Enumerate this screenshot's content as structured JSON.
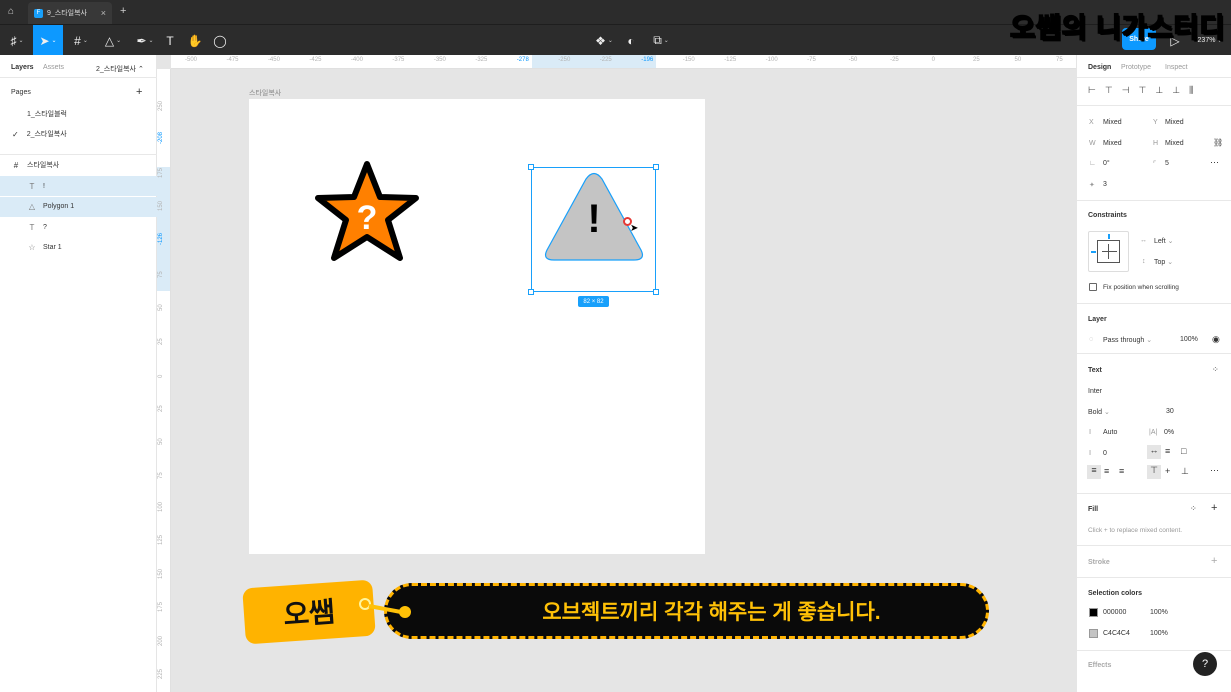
{
  "titlebar": {
    "tab_title": "9_스타일복사",
    "new_tab": "+"
  },
  "toolbar": {
    "share": "Share",
    "zoom": "237%"
  },
  "left_panel": {
    "tabs": [
      "Layers",
      "Assets"
    ],
    "current_page_dropdown": "2_스타일복사",
    "pages_title": "Pages",
    "pages": [
      {
        "name": "1_스타일블럭",
        "selected": false
      },
      {
        "name": "2_스타일복사",
        "selected": true
      }
    ],
    "frame_name": "스타일복사",
    "layers": [
      {
        "icon": "text-icon",
        "name": "!",
        "selected": true
      },
      {
        "icon": "polygon-icon",
        "name": "Polygon 1",
        "selected": true
      },
      {
        "icon": "text-icon",
        "name": "?",
        "selected": false
      },
      {
        "icon": "star-icon",
        "name": "Star 1",
        "selected": false
      }
    ]
  },
  "rulers": {
    "top": [
      "-500",
      "-475",
      "-450",
      "-425",
      "-400",
      "-375",
      "-350",
      "-325",
      "-278",
      "-250",
      "-225",
      "-196",
      "-150",
      "-125",
      "-100",
      "-75",
      "-50",
      "-25",
      "0",
      "25",
      "50",
      "75"
    ],
    "top_highlight": [
      "-278",
      "-196"
    ],
    "left": [
      "250",
      "-208",
      "175",
      "150",
      "-126",
      "75",
      "50",
      "25",
      "0",
      "25",
      "50",
      "75",
      "100",
      "125",
      "150",
      "175",
      "200",
      "225"
    ],
    "left_highlight": [
      "-208",
      "-126"
    ]
  },
  "canvas": {
    "frame_label": "스타일복사",
    "star_mark": "?",
    "triangle_mark": "!",
    "size_badge": "82 × 82"
  },
  "right_panel": {
    "tabs": [
      "Design",
      "Prototype",
      "Inspect"
    ],
    "x_label": "X",
    "x_value": "Mixed",
    "y_label": "Y",
    "y_value": "Mixed",
    "w_label": "W",
    "w_value": "Mixed",
    "h_label": "H",
    "h_value": "Mixed",
    "rotation": "0°",
    "radius": "5",
    "count": "3",
    "constraints_title": "Constraints",
    "constraint_h": "Left",
    "constraint_v": "Top",
    "fix_position": "Fix position when scrolling",
    "layer_title": "Layer",
    "blend": "Pass through",
    "opacity": "100%",
    "text_title": "Text",
    "font": "Inter",
    "weight": "Bold",
    "size": "30",
    "line_height": "Auto",
    "letter_spacing": "0%",
    "paragraph": "0",
    "fill_title": "Fill",
    "fill_hint": "Click + to replace mixed content.",
    "stroke_title": "Stroke",
    "selection_colors_title": "Selection colors",
    "colors": [
      {
        "hex": "000000",
        "opacity": "100%",
        "swatch": "#000000"
      },
      {
        "hex": "C4C4C4",
        "opacity": "100%",
        "swatch": "#c4c4c4"
      }
    ],
    "effects_title": "Effects"
  },
  "overlay": {
    "brand": "오쌤의 니가스터디",
    "speaker": "오쌤",
    "caption": "오브젝트끼리 각각 해주는 게 좋습니다."
  },
  "help": "?",
  "colors": {
    "accent": "#0d99ff",
    "star_fill": "#ff8000",
    "triangle_fill": "#c4c4c4",
    "overlay_yellow": "#ffc107"
  }
}
